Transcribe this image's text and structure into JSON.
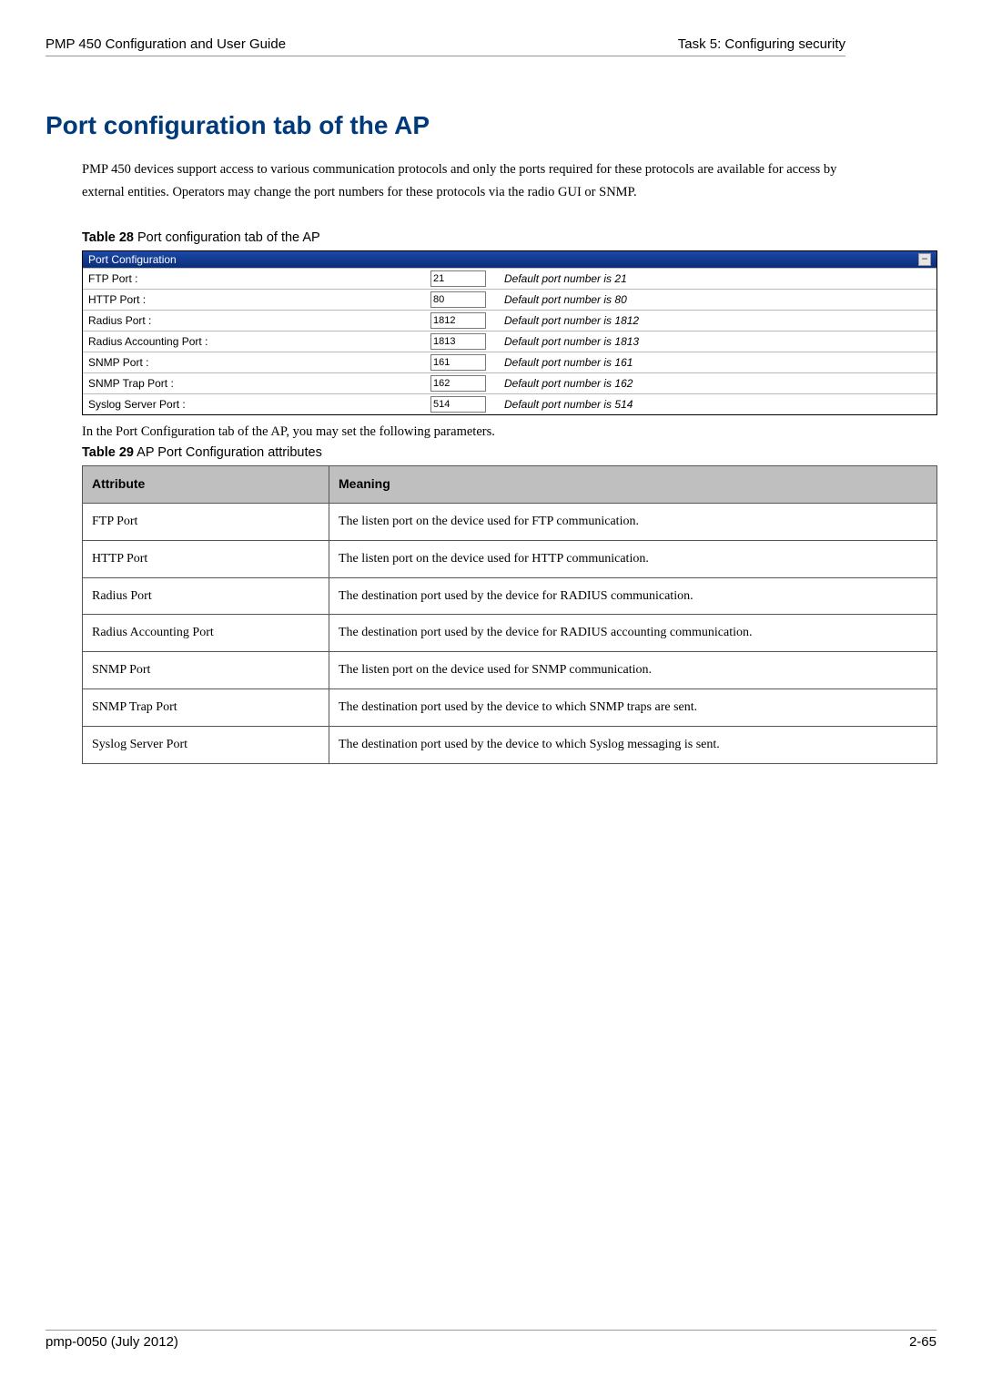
{
  "header": {
    "left": "PMP 450 Configuration and User Guide",
    "right": "Task 5: Configuring security"
  },
  "title": "Port configuration tab of the AP",
  "intro": "PMP 450 devices support access to various communication protocols and only the ports required for these protocols are available for access by external entities.  Operators may change the port numbers for these protocols via the radio GUI or SNMP.",
  "table28": {
    "label_bold": "Table 28",
    "label_rest": "  Port configuration tab of the AP",
    "panel_title": "Port Configuration",
    "rows": [
      {
        "label": "FTP Port :",
        "value": "21",
        "hint": "Default port number is 21"
      },
      {
        "label": "HTTP Port :",
        "value": "80",
        "hint": "Default port number is 80"
      },
      {
        "label": "Radius Port :",
        "value": "1812",
        "hint": "Default port number is 1812"
      },
      {
        "label": "Radius Accounting Port :",
        "value": "1813",
        "hint": "Default port number is 1813"
      },
      {
        "label": "SNMP Port :",
        "value": "161",
        "hint": "Default port number is 161"
      },
      {
        "label": "SNMP Trap Port :",
        "value": "162",
        "hint": "Default port number is 162"
      },
      {
        "label": "Syslog Server Port :",
        "value": "514",
        "hint": "Default port number is 514"
      }
    ]
  },
  "subtext": "In the Port Configuration tab of the AP, you may set the following parameters.",
  "table29": {
    "label_bold": "Table 29",
    "label_rest": "  AP Port Configuration attributes",
    "headers": {
      "col1": "Attribute",
      "col2": "Meaning"
    },
    "rows": [
      {
        "attr": "FTP Port",
        "meaning": "The listen port on the device used for FTP communication."
      },
      {
        "attr": "HTTP Port",
        "meaning": "The listen port on the device used for HTTP communication."
      },
      {
        "attr": "Radius Port",
        "meaning": "The destination port used by the device for RADIUS communication."
      },
      {
        "attr": "Radius Accounting Port",
        "meaning": "The destination port used by the device for RADIUS accounting communication."
      },
      {
        "attr": "SNMP Port",
        "meaning": "The listen port on the device used for SNMP communication."
      },
      {
        "attr": "SNMP Trap Port",
        "meaning": "The destination port used by the device to which SNMP traps are sent."
      },
      {
        "attr": "Syslog Server Port",
        "meaning": "The destination port used by the device to which Syslog messaging is sent."
      }
    ]
  },
  "footer": {
    "left": "pmp-0050 (July 2012)",
    "right": "2-65"
  }
}
